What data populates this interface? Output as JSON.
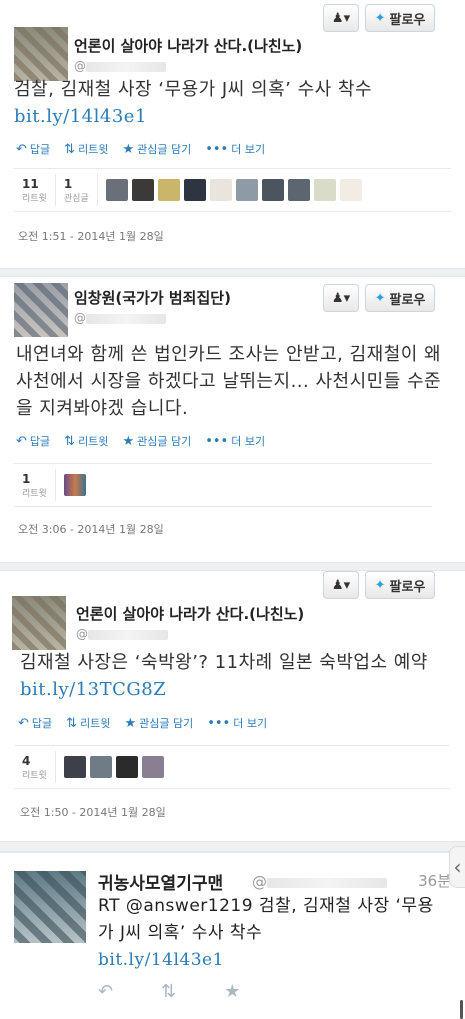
{
  "follow": {
    "user_menu": "▾",
    "follow_label": "팔로우"
  },
  "tweets": [
    {
      "name": "언론이 살아야 나라가 산다.(나친노)",
      "handle": "@",
      "text": "검찰, 김재철 사장 ‘무용가 J씨 의혹’ 수사 착수",
      "link": "bit.ly/14l43e1",
      "actions": {
        "reply": "답글",
        "retweet": "리트윗",
        "favorite": "관심글 담기",
        "more": "더 보기"
      },
      "stats": [
        {
          "num": "11",
          "label": "리트윗"
        },
        {
          "num": "1",
          "label": "관심글"
        }
      ],
      "time": "오전 1:51 - 2014년 1월 28일"
    },
    {
      "name": "임창원(국가가 범죄집단)",
      "handle": "@",
      "text": "내연녀와 함께 쓴 법인카드 조사는 안받고, 김재철이 왜 사천에서 시장을 하겠다고 날뛰는지... 사천시민들 수준을 지켜봐야겠 습니다.",
      "actions": {
        "reply": "답글",
        "retweet": "리트윗",
        "favorite": "관심글 담기",
        "more": "더 보기"
      },
      "stats": [
        {
          "num": "1",
          "label": "리트윗"
        }
      ],
      "time": "오전 3:06 - 2014년 1월 28일"
    },
    {
      "name": "언론이 살아야 나라가 산다.(나친노)",
      "handle": "@",
      "text": "김재철 사장은 ‘숙박왕’? 11차례 일본 숙박업소 예약",
      "link": "bit.ly/13TCG8Z",
      "actions": {
        "reply": "답글",
        "retweet": "리트윗",
        "favorite": "관심글 담기",
        "more": "더 보기"
      },
      "stats": [
        {
          "num": "4",
          "label": "리트윗"
        }
      ],
      "time": "오전 1:50 - 2014년 1월 28일"
    }
  ],
  "stream": {
    "name": "귀농사모열기구맨",
    "handle": "@",
    "ago": "36분",
    "text": "RT @answer1219 검찰, 김재철 사장 ‘무용가 J씨 의혹’ 수사 착수",
    "link": "bit.ly/14l43e1"
  },
  "icons": {
    "reply": "reply-icon",
    "retweet": "retweet-icon",
    "favorite": "star-icon",
    "more": "more-dots-icon",
    "person": "person-icon",
    "bird": "bird-icon"
  },
  "colors": {
    "link": "#2b7bb9",
    "bird": "#2b9fe0",
    "stream_icons": "#aab8c2"
  }
}
